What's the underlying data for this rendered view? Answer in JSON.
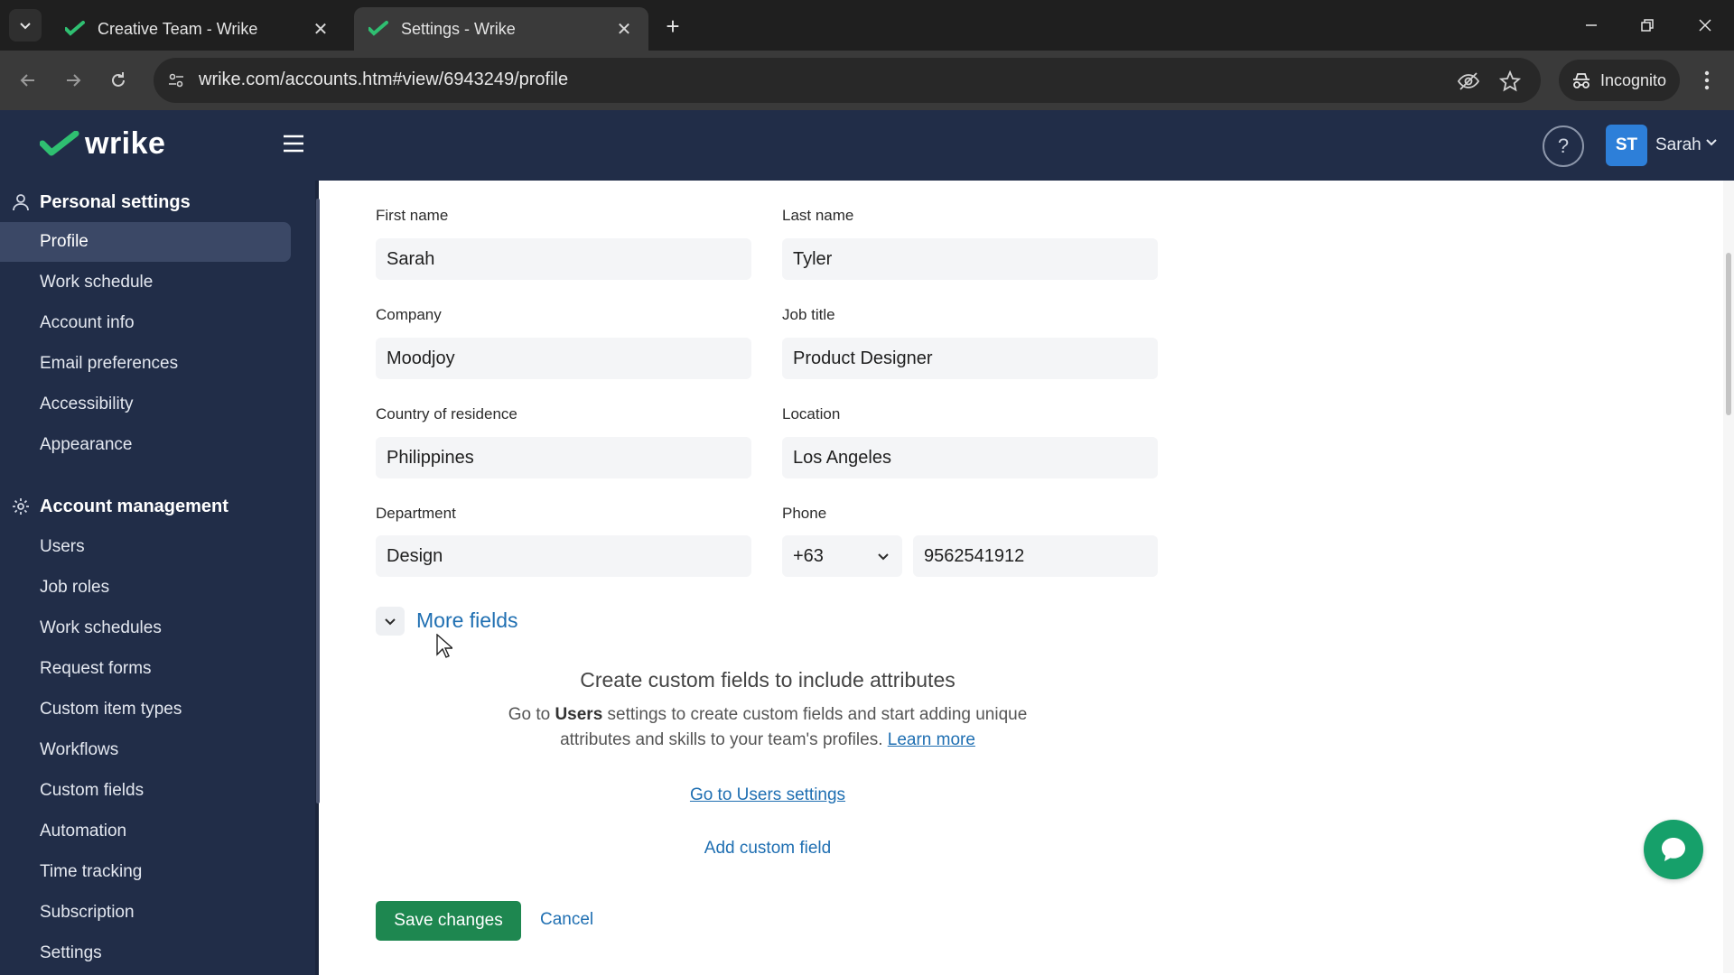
{
  "browser": {
    "tabs": [
      {
        "title": "Creative Team - Wrike",
        "active": false
      },
      {
        "title": "Settings - Wrike",
        "active": true
      }
    ],
    "url": "wrike.com/accounts.htm#view/6943249/profile",
    "incognito_label": "Incognito"
  },
  "header": {
    "logo_text": "wrike",
    "avatar_initials": "ST",
    "user_name": "Sarah",
    "help_glyph": "?"
  },
  "sidebar": {
    "personal": {
      "title": "Personal settings",
      "items": [
        "Profile",
        "Work schedule",
        "Account info",
        "Email preferences",
        "Accessibility",
        "Appearance"
      ]
    },
    "account": {
      "title": "Account management",
      "items": [
        "Users",
        "Job roles",
        "Work schedules",
        "Request forms",
        "Custom item types",
        "Workflows",
        "Custom fields",
        "Automation",
        "Time tracking",
        "Subscription",
        "Settings"
      ]
    },
    "active_item": "Profile"
  },
  "form": {
    "first_name": {
      "label": "First name",
      "value": "Sarah"
    },
    "last_name": {
      "label": "Last name",
      "value": "Tyler"
    },
    "company": {
      "label": "Company",
      "value": "Moodjoy"
    },
    "job_title": {
      "label": "Job title",
      "value": "Product Designer"
    },
    "country": {
      "label": "Country of residence",
      "value": "Philippines"
    },
    "location": {
      "label": "Location",
      "value": "Los Angeles"
    },
    "department": {
      "label": "Department",
      "value": "Design"
    },
    "phone": {
      "label": "Phone",
      "code": "+63",
      "number": "9562541912"
    },
    "more_fields_label": "More fields"
  },
  "custom_fields": {
    "title": "Create custom fields to include attributes",
    "desc_prefix": "Go to ",
    "desc_bold": "Users",
    "desc_middle": " settings to create custom fields and start adding unique attributes and skills to your team's profiles. ",
    "learn_more": "Learn more",
    "go_to_users": "Go to Users settings",
    "add_custom": "Add custom field"
  },
  "actions": {
    "save": "Save changes",
    "cancel": "Cancel"
  },
  "colors": {
    "header_bg": "#212d48",
    "accent_green": "#1e8750",
    "link_blue": "#1f6fb2",
    "avatar_blue": "#2d7fd9"
  }
}
